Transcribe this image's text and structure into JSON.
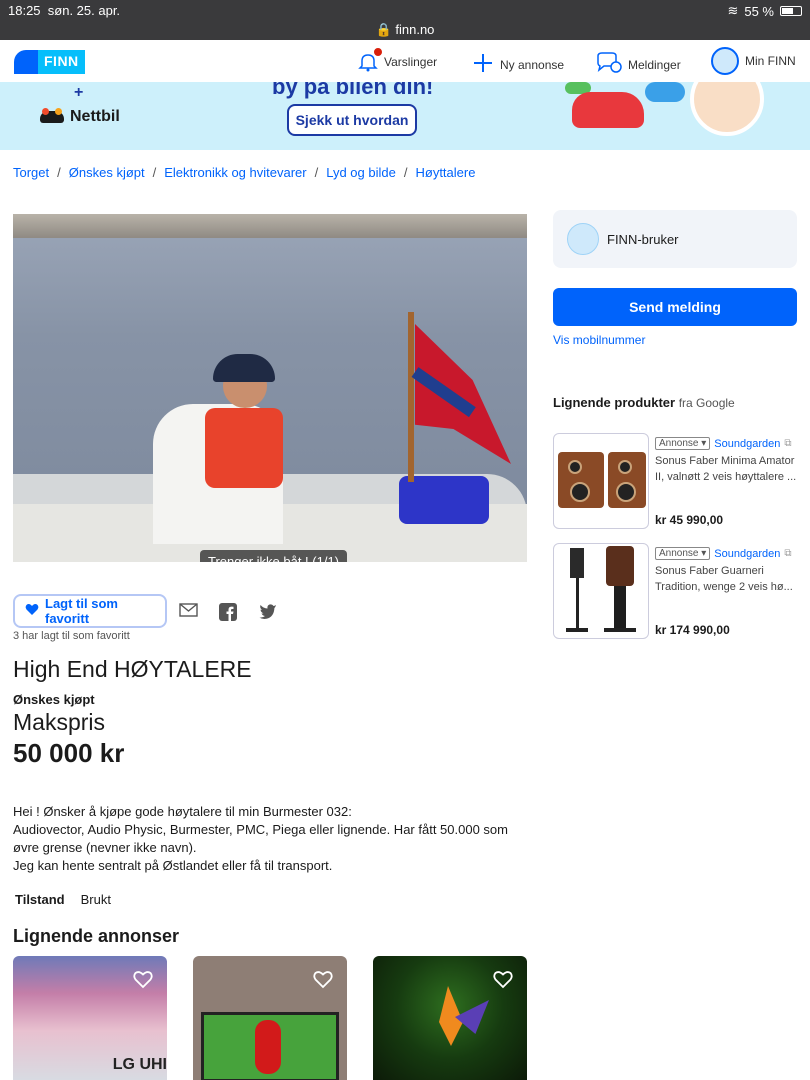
{
  "status": {
    "time": "18:25",
    "date": "søn. 25. apr.",
    "url": "finn.no",
    "battery": "55 %"
  },
  "nav": {
    "logo": "FINN",
    "varslinger": "Varslinger",
    "ny_annonse": "Ny annonse",
    "meldinger": "Meldinger",
    "min_finn": "Min FINN"
  },
  "banner": {
    "headline": "by på bilen din!",
    "plus": "+",
    "partner": "Nettbil",
    "cta": "Sjekk ut hvordan"
  },
  "breadcrumb": [
    "Torget",
    "Ønskes kjøpt",
    "Elektronikk og hvitevarer",
    "Lyd og bilde",
    "Høyttalere"
  ],
  "breadcrumb_sep": "/",
  "image_caption": "Trenger ikke båt ! (1/1)",
  "favorite": {
    "label": "Lagt til som favoritt",
    "count_text": "3 har lagt til som favoritt"
  },
  "ad": {
    "title": "High End HØYTALERE",
    "type": "Ønskes kjøpt",
    "price_label": "Makspris",
    "price": "50 000 kr",
    "description": [
      "Hei ! Ønsker å kjøpe gode høytalere til min Burmester 032:",
      "Audiovector, Audio Physic, Burmester, PMC, Piega eller lignende. Har fått 50.000 som øvre grense (nevner ikke navn).",
      "Jeg kan hente sentralt på Østlandet eller få til transport."
    ],
    "condition_key": "Tilstand",
    "condition_value": "Brukt"
  },
  "similar_title": "Lignende annonser",
  "similar_card1_text": "LG UHI",
  "seller": {
    "name": "FINN-bruker",
    "send": "Send melding",
    "mobile": "Vis mobilnummer"
  },
  "products_title": "Lignende produkter",
  "products_source": "fra Google",
  "products": [
    {
      "tag": "Annonse ▾",
      "shop": "Soundgarden",
      "name": "Sonus Faber Minima Amator II, valnøtt 2 veis høyttalere ...",
      "price": "kr 45 990,00"
    },
    {
      "tag": "Annonse ▾",
      "shop": "Soundgarden",
      "name": "Sonus Faber Guarneri Tradition, wenge 2 veis hø...",
      "price": "kr 174 990,00"
    }
  ],
  "colors": {
    "brand": "#0063fb",
    "finn_light": "#06befb",
    "banner_bg": "#cdf0fb"
  }
}
